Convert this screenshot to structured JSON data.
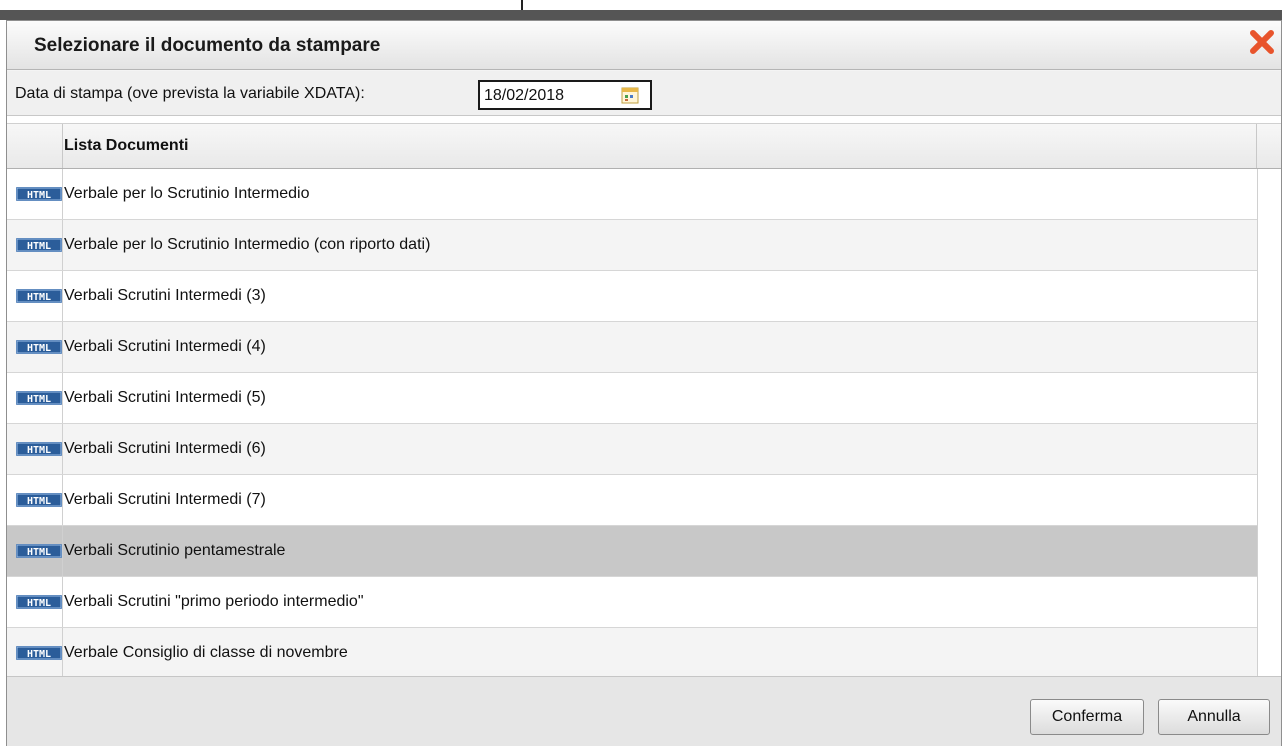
{
  "dialog": {
    "title": "Selezionare il documento da stampare",
    "close_icon": "close-x-icon",
    "accent_close_color": "#e8542c"
  },
  "date": {
    "label": "Data di stampa (ove prevista la variabile XDATA):",
    "value": "18/02/2018",
    "calendar_icon": "calendar-icon"
  },
  "grid": {
    "column_header": "Lista Documenti",
    "row_icon": "html-file-icon",
    "rows": [
      {
        "label": "Verbale per lo Scrutinio Intermedio"
      },
      {
        "label": "Verbale per lo Scrutinio Intermedio (con riporto dati)"
      },
      {
        "label": "Verbali Scrutini Intermedi (3)"
      },
      {
        "label": "Verbali Scrutini Intermedi (4)"
      },
      {
        "label": "Verbali Scrutini Intermedi (5)"
      },
      {
        "label": "Verbali Scrutini Intermedi (6)"
      },
      {
        "label": "Verbali Scrutini Intermedi (7)"
      },
      {
        "label": "Verbali Scrutinio pentamestrale"
      },
      {
        "label": "Verbali Scrutini \"primo periodo intermedio\""
      },
      {
        "label": "Verbale Consiglio di classe di novembre"
      }
    ],
    "selected_index": 7
  },
  "footer": {
    "confirm_label": "Conferma",
    "cancel_label": "Annulla"
  }
}
